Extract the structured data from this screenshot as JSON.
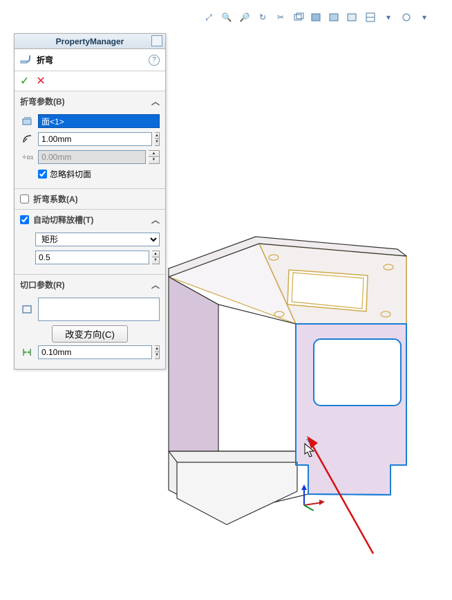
{
  "pm_title": "PropertyManager",
  "feature": {
    "name": "折弯"
  },
  "ok_glyph": "✓",
  "cancel_glyph": "✕",
  "help_glyph": "?",
  "chev_glyph": "︿",
  "sections": {
    "bendParams": {
      "title": "折弯参数(B)",
      "face_value": "面<1>",
      "radius_value": "1.00mm",
      "offset_value": "0.00mm",
      "ignore_bevel_label": "忽略斜切面",
      "ignore_bevel_checked": true
    },
    "bendCoef": {
      "title": "折弯系数(A)",
      "checked": false
    },
    "relief": {
      "title": "自动切释放槽(T)",
      "checked": true,
      "type_option": "矩形",
      "ratio_value": "0.5"
    },
    "cutParams": {
      "title": "切口参数(R)",
      "reverse_label": "改变方向(C)",
      "gap_value": "0.10mm"
    }
  },
  "toolbar_icons": [
    "zoom-fit",
    "zoom-area",
    "zoom-in",
    "rotate",
    "pan",
    "view-normal",
    "shaded-edges",
    "shaded",
    "hidden-removed",
    "section",
    "scene",
    "display-state",
    "dropdown"
  ]
}
